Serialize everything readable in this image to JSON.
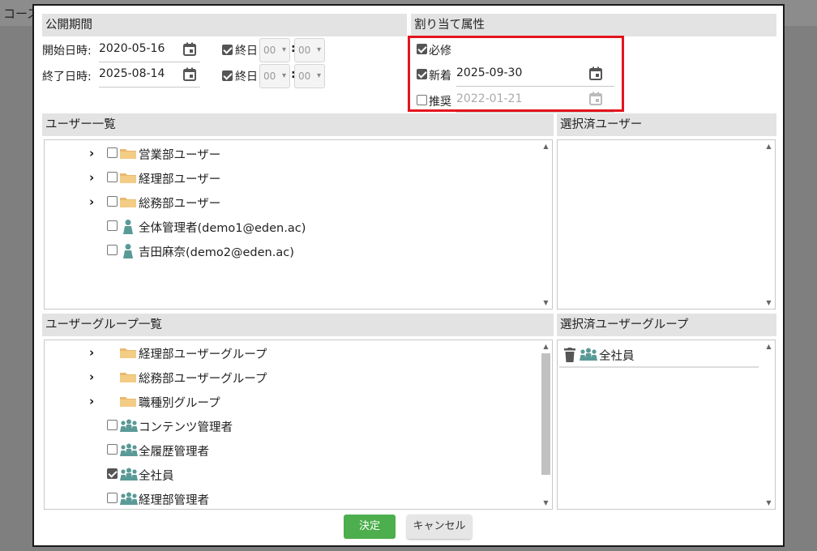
{
  "background": {
    "title_partial": "コース"
  },
  "dialog": {
    "publish": {
      "header": "公開期間",
      "start_label": "開始日時:",
      "start_date": "2020-05-16",
      "start_allday_label": "終日",
      "start_hour": "00",
      "start_minute": "00",
      "end_label": "終了日時:",
      "end_date": "2025-08-14",
      "end_allday_label": "終日",
      "end_hour": "00",
      "end_minute": "00",
      "colon": ":"
    },
    "attributes": {
      "header": "割り当て属性",
      "required_label": "必修",
      "required_checked": true,
      "new_label": "新着",
      "new_checked": true,
      "new_date": "2025-09-30",
      "recommend_label": "推奨",
      "recommend_checked": false,
      "recommend_date": "2022-01-21",
      "highlight_color": "#e3141d"
    },
    "user_list": {
      "header": "ユーザー一覧",
      "items": [
        {
          "type": "folder",
          "label": "営業部ユーザー"
        },
        {
          "type": "folder",
          "label": "経理部ユーザー"
        },
        {
          "type": "folder",
          "label": "総務部ユーザー"
        },
        {
          "type": "user",
          "label": "全体管理者(demo1@eden.ac)"
        },
        {
          "type": "user",
          "label": "吉田麻奈(demo2@eden.ac)"
        }
      ]
    },
    "selected_users": {
      "header": "選択済ユーザー"
    },
    "group_list": {
      "header": "ユーザーグループ一覧",
      "items": [
        {
          "type": "folder",
          "label": "経理部ユーザーグループ"
        },
        {
          "type": "folder",
          "label": "総務部ユーザーグループ"
        },
        {
          "type": "folder",
          "label": "職種別グループ"
        },
        {
          "type": "group",
          "label": "コンテンツ管理者",
          "checked": false
        },
        {
          "type": "group",
          "label": "全履歴管理者",
          "checked": false
        },
        {
          "type": "group",
          "label": "全社員",
          "checked": true
        },
        {
          "type": "group",
          "label": "経理部管理者",
          "checked": false
        }
      ]
    },
    "selected_groups": {
      "header": "選択済ユーザーグループ",
      "items": [
        {
          "label": "全社員"
        }
      ]
    },
    "buttons": {
      "ok_label": "決定",
      "cancel_label": "キャンセル"
    },
    "colors": {
      "ok_green": "#4cae4c",
      "icon_teal": "#5a9a96",
      "folder": "#e9b96e"
    }
  }
}
